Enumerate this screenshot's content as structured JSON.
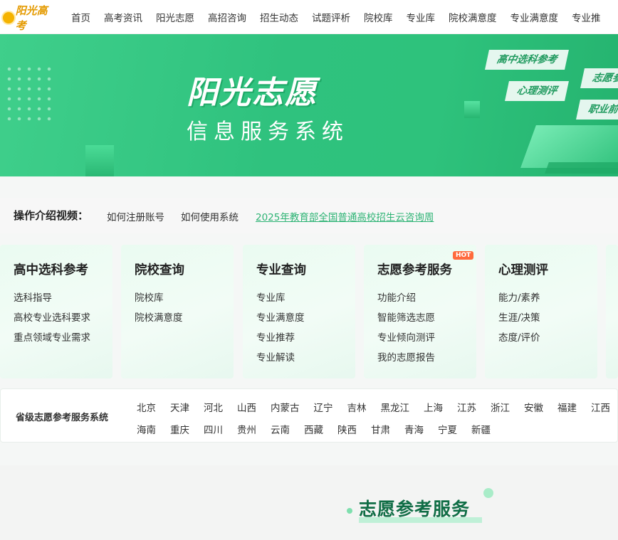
{
  "logo": {
    "text": "阳光高考"
  },
  "nav": [
    "首页",
    "高考资讯",
    "阳光志愿",
    "高招咨询",
    "招生动态",
    "试题评析",
    "院校库",
    "专业库",
    "院校满意度",
    "专业满意度",
    "专业推"
  ],
  "banner": {
    "title": "阳光志愿",
    "subtitle": "信息服务系统",
    "tags": [
      "高中选科参考",
      "志愿参",
      "心理测评",
      "职业前"
    ]
  },
  "intro": {
    "label": "操作介绍视频：",
    "links": [
      "如何注册账号",
      "如何使用系统",
      "2025年教育部全国普通高校招生云咨询周"
    ]
  },
  "cards": [
    {
      "title": "高中选科参考",
      "items": [
        "选科指导",
        "高校专业选科要求",
        "重点领域专业需求"
      ]
    },
    {
      "title": "院校查询",
      "items": [
        "院校库",
        "院校满意度"
      ]
    },
    {
      "title": "专业查询",
      "items": [
        "专业库",
        "专业满意度",
        "专业推荐",
        "专业解读"
      ]
    },
    {
      "title": "志愿参考服务",
      "badge": "HOT",
      "items": [
        "功能介绍",
        "智能筛选志愿",
        "专业倾向测评",
        "我的志愿报告"
      ]
    },
    {
      "title": "心理测评",
      "items": [
        "能力/素养",
        "生涯/决策",
        "态度/评价"
      ]
    }
  ],
  "provinces": {
    "label": "省级志愿参考服务系统",
    "row1": [
      "北京",
      "天津",
      "河北",
      "山西",
      "内蒙古",
      "辽宁",
      "吉林",
      "黑龙江",
      "上海",
      "江苏",
      "浙江",
      "安徽",
      "福建",
      "江西"
    ],
    "row2": [
      "海南",
      "重庆",
      "四川",
      "贵州",
      "云南",
      "西藏",
      "陕西",
      "甘肃",
      "青海",
      "宁夏",
      "新疆"
    ]
  },
  "section": {
    "title": "志愿参考服务"
  },
  "colors": {
    "brand_green": "#2ec27c",
    "link_green": "#2db374",
    "hot_badge": "#ff6a3d",
    "logo_gold": "#e49a00"
  }
}
